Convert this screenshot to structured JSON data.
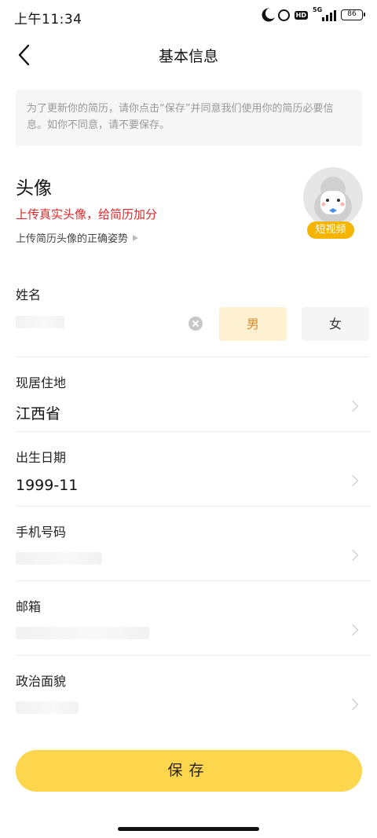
{
  "status_bar": {
    "time": "上午11:34",
    "network": "5G",
    "hd": "HD",
    "battery": "86"
  },
  "nav": {
    "title": "基本信息",
    "back_icon": "chevron-left-icon"
  },
  "notice": {
    "text": "为了更新你的简历，请你点击“保存”并同意我们使用你的简历必要信息。如你不同意，请不要保存。"
  },
  "avatar_section": {
    "title": "头像",
    "tip": "上传真实头像，给简历加分",
    "guide_link": "上传简历头像的正确姿势",
    "badge": "短视频"
  },
  "fields": {
    "name": {
      "label": "姓名",
      "value": ""
    },
    "gender": {
      "male": "男",
      "female": "女",
      "selected": "男"
    },
    "residence": {
      "label": "现居住地",
      "value": "江西省"
    },
    "birth": {
      "label": "出生日期",
      "value": "1999-11"
    },
    "phone": {
      "label": "手机号码",
      "value": ""
    },
    "email": {
      "label": "邮箱",
      "value": ""
    },
    "politics": {
      "label": "政治面貌",
      "value": ""
    }
  },
  "save_button": {
    "label": "保存"
  },
  "colors": {
    "accent": "#fdd64d",
    "tip_red": "#d9292b",
    "male_bg": "#fdf1d1",
    "male_text": "#e28a2b",
    "badge": "#f5b400"
  }
}
